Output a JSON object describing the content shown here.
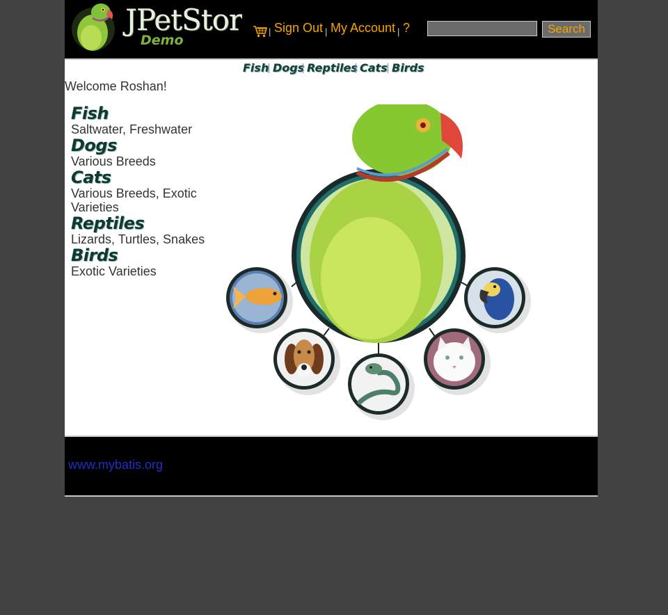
{
  "header": {
    "logo": {
      "title": "JPetStore",
      "subtitle": "Demo"
    },
    "menu": {
      "cart_icon": "shopping-cart-icon",
      "separator": "|",
      "sign_out": "Sign Out",
      "my_account": "My Account",
      "help": "?"
    },
    "search": {
      "value": "",
      "button_label": "Search"
    }
  },
  "quick_links": [
    "Fish",
    "Dogs",
    "Reptiles",
    "Cats",
    "Birds"
  ],
  "welcome": "Welcome Roshan!",
  "sidebar": {
    "categories": [
      {
        "name": "Fish",
        "description": "Saltwater, Freshwater"
      },
      {
        "name": "Dogs",
        "description": "Various Breeds"
      },
      {
        "name": "Cats",
        "description": "Various Breeds, Exotic Varieties"
      },
      {
        "name": "Reptiles",
        "description": "Lizards, Turtles, Snakes"
      },
      {
        "name": "Birds",
        "description": "Exotic Varieties"
      }
    ]
  },
  "main_image": {
    "parts": [
      "parrot",
      "fish",
      "dog",
      "reptile",
      "cat",
      "macaw"
    ]
  },
  "footer": {
    "link": "www.mybatis.org"
  },
  "colors": {
    "page_background": "#424242",
    "header_background": "#000000",
    "menu_link": "#f5a400",
    "footer_link": "#1d2fc8",
    "category_title": "#0f3a33"
  }
}
